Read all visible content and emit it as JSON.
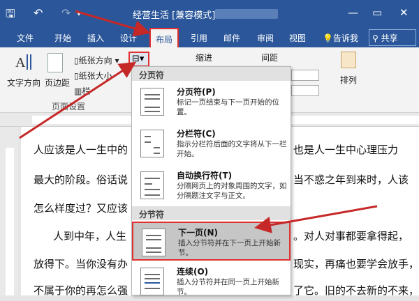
{
  "window": {
    "title": "经营生活 [兼容模式]...",
    "controls": {
      "minimize": "—",
      "restore": "▭",
      "close": "✕"
    },
    "quick_access": {
      "save": "🖫",
      "undo": "↶",
      "redo": "↷",
      "dropdown": "▾"
    }
  },
  "ribbon_tabs": [
    {
      "label": "文件"
    },
    {
      "label": "开始"
    },
    {
      "label": "插入"
    },
    {
      "label": "设计"
    },
    {
      "label": "布局",
      "active": true
    },
    {
      "label": "引用"
    },
    {
      "label": "邮件"
    },
    {
      "label": "审阅"
    },
    {
      "label": "视图"
    }
  ],
  "tell_me": "告诉我",
  "share": "共享",
  "ribbon": {
    "text_direction": "文字方向",
    "margins": "页边距",
    "orientation": "纸张方向",
    "size": "纸张大小",
    "columns": "栏",
    "indent": "缩进",
    "spacing": "间距",
    "arrange": "排列",
    "group_page_setup": "页面设置"
  },
  "breaks_menu": {
    "section_page_breaks": "分页符",
    "section_section_breaks": "分节符",
    "items": [
      {
        "title": "分页符(P)",
        "desc": "标记一页结束与下一页开始的位置。"
      },
      {
        "title": "分栏符(C)",
        "desc": "指示分栏符后面的文字将从下一栏开始。"
      },
      {
        "title": "自动换行符(T)",
        "desc": "分隔网页上的对象周围的文字，如分隔题注文字与正文。"
      },
      {
        "title": "下一页(N)",
        "desc": "插入分节符并在下一页上开始新节。",
        "selected": true
      },
      {
        "title": "连续(O)",
        "desc": "插入分节符并在同一页上开始新节。"
      }
    ]
  },
  "document": {
    "lines": [
      {
        "left": "人应该是人一生中的",
        "right": "也是人一生中心理压力"
      },
      {
        "left": "最大的阶段。俗话说",
        "right": "当不惑之年到来时，人该"
      },
      {
        "left": "怎么样度过？又应该",
        "right": ""
      },
      {
        "left": "人到中年，人生",
        "right": "。对人对事都要拿得起，"
      },
      {
        "left": "放得下。当你没有办",
        "right": "现实，再痛也要学会放手，"
      },
      {
        "left": "不属于你的再怎么强",
        "right": "了它。旧的不去新的不来，"
      }
    ]
  },
  "colors": {
    "title_blue": "#2b579a",
    "highlight_red": "#e03030"
  }
}
